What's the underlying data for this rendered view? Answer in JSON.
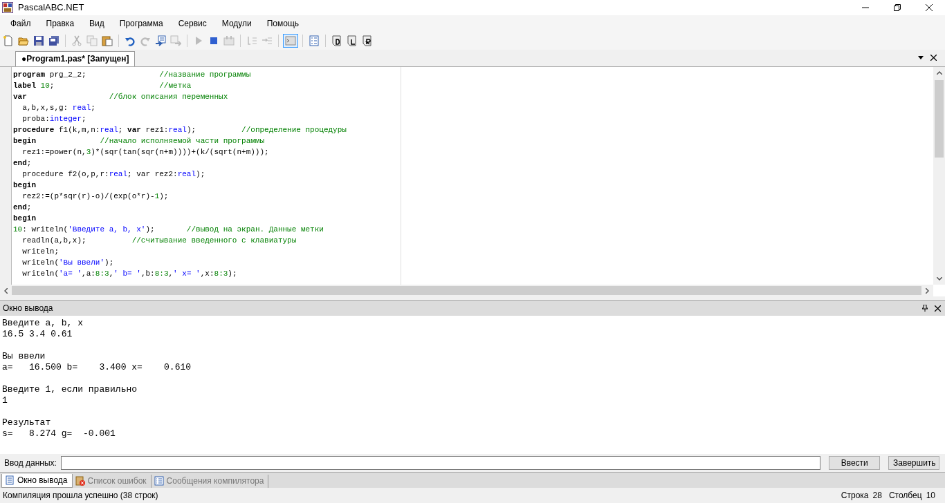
{
  "window": {
    "title": "PascalABC.NET"
  },
  "menu": [
    "Файл",
    "Правка",
    "Вид",
    "Программа",
    "Сервис",
    "Модули",
    "Помощь"
  ],
  "toolbar": [
    [
      {
        "kind": "new",
        "disabled": false,
        "selected": false
      },
      {
        "kind": "open",
        "disabled": false,
        "selected": false
      },
      {
        "kind": "save",
        "disabled": false,
        "selected": false
      },
      {
        "kind": "saveall",
        "disabled": false,
        "selected": false
      }
    ],
    [
      {
        "kind": "cut",
        "disabled": true,
        "selected": false
      },
      {
        "kind": "copy",
        "disabled": true,
        "selected": false
      },
      {
        "kind": "paste",
        "disabled": false,
        "selected": false
      }
    ],
    [
      {
        "kind": "undo",
        "disabled": false,
        "selected": false
      },
      {
        "kind": "redo",
        "disabled": true,
        "selected": false
      },
      {
        "kind": "indent",
        "disabled": false,
        "selected": false
      },
      {
        "kind": "unindent",
        "disabled": true,
        "selected": false
      }
    ],
    [
      {
        "kind": "run",
        "disabled": true,
        "selected": false
      },
      {
        "kind": "stop",
        "disabled": false,
        "selected": false
      },
      {
        "kind": "build",
        "disabled": true,
        "selected": false
      }
    ],
    [
      {
        "kind": "stepin",
        "disabled": true,
        "selected": false
      },
      {
        "kind": "stepover",
        "disabled": true,
        "selected": false
      }
    ],
    [
      {
        "kind": "console",
        "disabled": false,
        "selected": true
      }
    ],
    [
      {
        "kind": "list",
        "disabled": false,
        "selected": false
      }
    ],
    [
      {
        "kind": "docd",
        "disabled": false,
        "selected": false
      },
      {
        "kind": "docl",
        "disabled": false,
        "selected": false
      },
      {
        "kind": "docr",
        "disabled": false,
        "selected": false
      }
    ]
  ],
  "editor_tabs": [
    {
      "label": "●Program1.pas* [Запущен]",
      "selected": true
    }
  ],
  "code": [
    [
      {
        "kind": "kw",
        "text": "program"
      },
      {
        "kind": "plain",
        "text": " prg_2_2;                "
      },
      {
        "kind": "comment",
        "text": "//название программы"
      }
    ],
    [
      {
        "kind": "kw",
        "text": "label"
      },
      {
        "kind": "num",
        "text": " 10"
      },
      {
        "kind": "plain",
        "text": ";                       "
      },
      {
        "kind": "comment",
        "text": "//метка"
      }
    ],
    [
      {
        "kind": "kw",
        "text": "var"
      },
      {
        "kind": "comment",
        "text": "                  //блок описания переменных"
      }
    ],
    [
      {
        "kind": "plain",
        "text": "  a,b,x,s,g: "
      },
      {
        "kind": "type",
        "text": "real"
      },
      {
        "kind": "plain",
        "text": ";"
      }
    ],
    [
      {
        "kind": "plain",
        "text": "  proba:"
      },
      {
        "kind": "type",
        "text": "integer"
      },
      {
        "kind": "plain",
        "text": ";"
      }
    ],
    [
      {
        "kind": "kw",
        "text": "procedure"
      },
      {
        "kind": "plain",
        "text": " f1(k,m,n:"
      },
      {
        "kind": "type",
        "text": "real"
      },
      {
        "kind": "plain",
        "text": "; "
      },
      {
        "kind": "kw",
        "text": "var"
      },
      {
        "kind": "plain",
        "text": " rez1:"
      },
      {
        "kind": "type",
        "text": "real"
      },
      {
        "kind": "plain",
        "text": ");          "
      },
      {
        "kind": "comment",
        "text": "//определение процедуры"
      }
    ],
    [
      {
        "kind": "kw",
        "text": "begin"
      },
      {
        "kind": "comment",
        "text": "              //начало исполняемой части программы"
      }
    ],
    [
      {
        "kind": "plain",
        "text": "  rez1:=power(n,"
      },
      {
        "kind": "num",
        "text": "3"
      },
      {
        "kind": "plain",
        "text": ")*(sqr(tan(sqr(n+m))))+(k/(sqrt(n+m)));"
      }
    ],
    [
      {
        "kind": "kw",
        "text": "end"
      },
      {
        "kind": "plain",
        "text": ";"
      }
    ],
    [
      {
        "kind": "plain",
        "text": "  procedure f2(o,p,r:"
      },
      {
        "kind": "type",
        "text": "real"
      },
      {
        "kind": "plain",
        "text": "; var rez2:"
      },
      {
        "kind": "type",
        "text": "real"
      },
      {
        "kind": "plain",
        "text": ");"
      }
    ],
    [
      {
        "kind": "kw",
        "text": "begin"
      }
    ],
    [
      {
        "kind": "plain",
        "text": "  rez2:=(p*sqr(r)-o)/(exp(o*r)-"
      },
      {
        "kind": "num",
        "text": "1"
      },
      {
        "kind": "plain",
        "text": ");"
      }
    ],
    [
      {
        "kind": "kw",
        "text": "end"
      },
      {
        "kind": "plain",
        "text": ";"
      }
    ],
    [
      {
        "kind": "kw",
        "text": "begin"
      }
    ],
    [
      {
        "kind": "num",
        "text": "10"
      },
      {
        "kind": "plain",
        "text": ": writeln("
      },
      {
        "kind": "str",
        "text": "'Введите a, b, x'"
      },
      {
        "kind": "plain",
        "text": ");       "
      },
      {
        "kind": "comment",
        "text": "//вывод на экран. Данные метки"
      }
    ],
    [
      {
        "kind": "plain",
        "text": "  readln(a,b,x);          "
      },
      {
        "kind": "comment",
        "text": "//считывание введенного с клавиатуры"
      }
    ],
    [
      {
        "kind": "plain",
        "text": "  writeln;"
      }
    ],
    [
      {
        "kind": "plain",
        "text": "  writeln("
      },
      {
        "kind": "str",
        "text": "'Вы ввели'"
      },
      {
        "kind": "plain",
        "text": ");"
      }
    ],
    [
      {
        "kind": "plain",
        "text": "  writeln("
      },
      {
        "kind": "str",
        "text": "'a= '"
      },
      {
        "kind": "plain",
        "text": ",a:"
      },
      {
        "kind": "num",
        "text": "8:3"
      },
      {
        "kind": "plain",
        "text": ","
      },
      {
        "kind": "str",
        "text": "' b= '"
      },
      {
        "kind": "plain",
        "text": ",b:"
      },
      {
        "kind": "num",
        "text": "8:3"
      },
      {
        "kind": "plain",
        "text": ","
      },
      {
        "kind": "str",
        "text": "' x= '"
      },
      {
        "kind": "plain",
        "text": ",x:"
      },
      {
        "kind": "num",
        "text": "8:3"
      },
      {
        "kind": "plain",
        "text": ");"
      }
    ]
  ],
  "output_panel": {
    "title": "Окно вывода",
    "blocks": [
      [
        "Введите a, b, x",
        "16.5 3.4 0.61"
      ],
      [
        "Вы ввели",
        "a=   16.500 b=    3.400 x=    0.610"
      ],
      [
        "Введите 1, если правильно",
        "1"
      ],
      [
        "Результат",
        "s=   8.274 g=  -0.001"
      ]
    ]
  },
  "input_row": {
    "label": "Ввод данных:",
    "buttons": [
      "Ввести",
      "Завершить"
    ]
  },
  "bottom_tabs": [
    {
      "label": "Окно вывода",
      "kind": "output",
      "selected": true
    },
    {
      "label": "Список ошибок",
      "kind": "errors",
      "selected": false
    },
    {
      "label": "Сообщения компилятора",
      "kind": "messages",
      "selected": false
    }
  ],
  "status_bar": {
    "message": "Компиляция прошла успешно (38 строк)",
    "fields": [
      {
        "label": "Строка",
        "value": "28"
      },
      {
        "label": "Столбец",
        "value": "10"
      }
    ]
  }
}
